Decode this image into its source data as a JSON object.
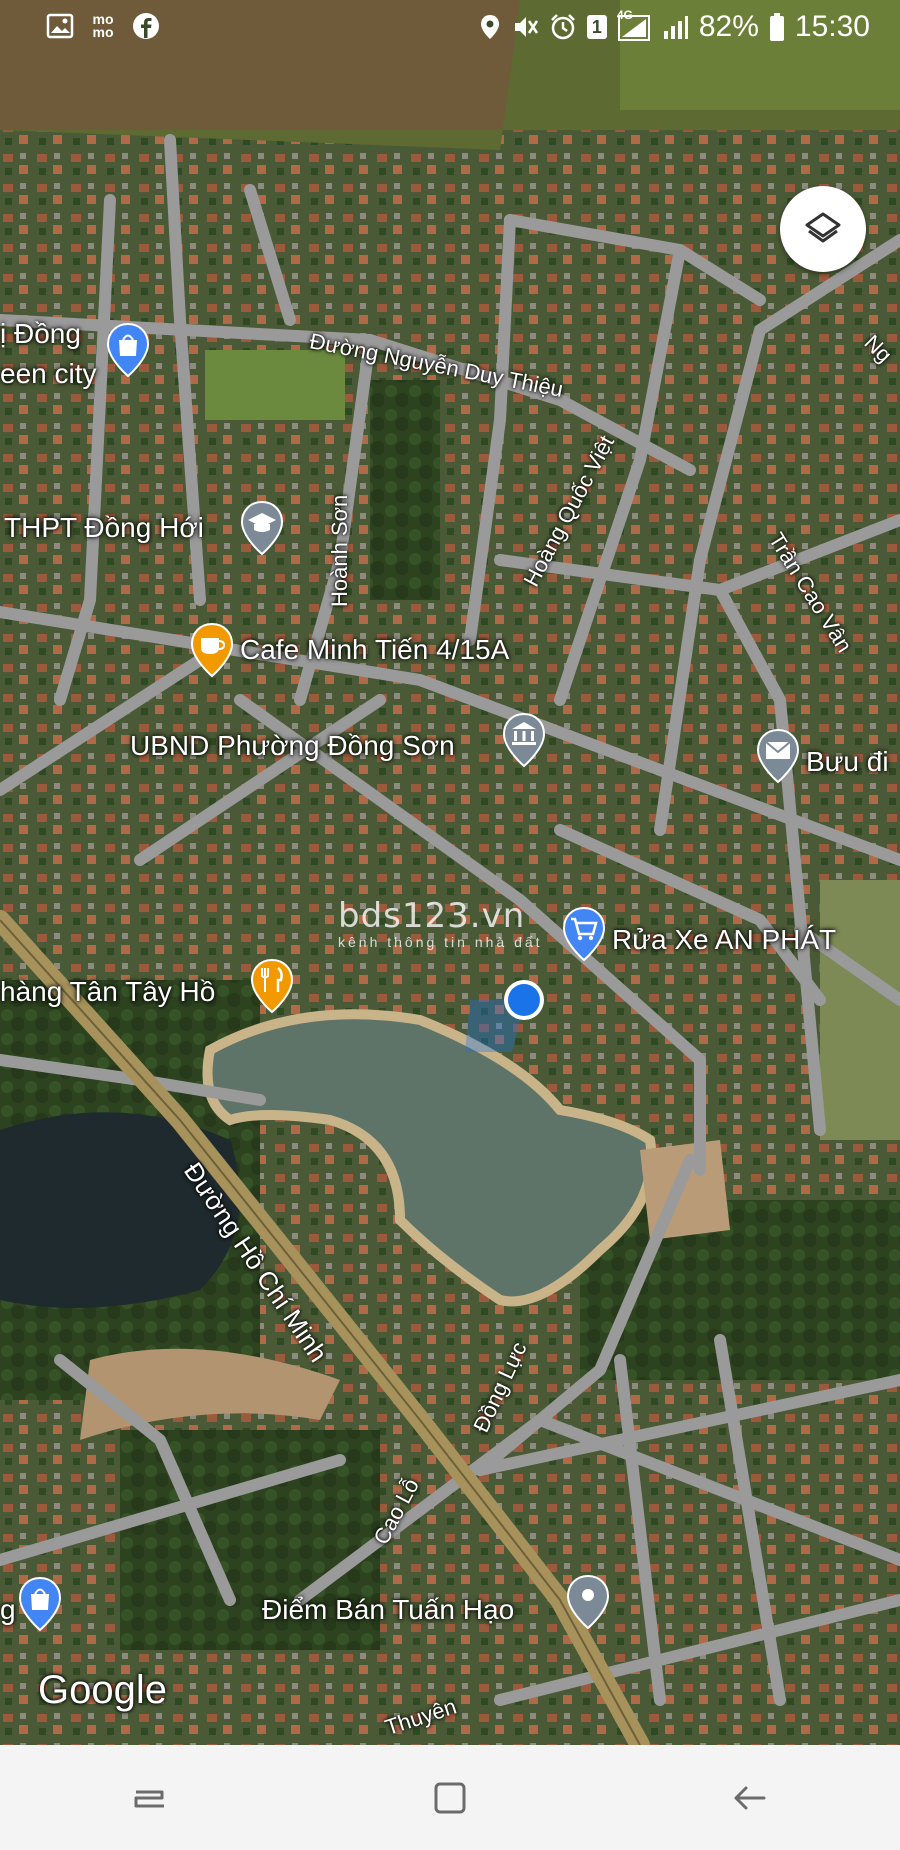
{
  "status_bar": {
    "left_icons": [
      "image-icon",
      "momo-icon",
      "facebook-icon"
    ],
    "momo_text": "mo mo",
    "right_icons": [
      "location-icon",
      "mute-icon",
      "alarm-icon",
      "sim-1-icon",
      "4g-signal-icon",
      "signal-icon",
      "battery-icon"
    ],
    "sim_label": "1",
    "network_label": "4G",
    "battery": "82%",
    "time": "15:30"
  },
  "map": {
    "places": [
      {
        "label": "ị Đồng",
        "icon": "shopping-bag-icon"
      },
      {
        "label": "een city"
      },
      {
        "label": "THPT Đồng Hới",
        "icon": "school-icon"
      },
      {
        "label": "Cafe Minh Tiến 4/15A",
        "icon": "cafe-icon"
      },
      {
        "label": "UBND Phường Đồng Sơn",
        "icon": "government-icon"
      },
      {
        "label": "Bưu đi",
        "icon": "mail-icon"
      },
      {
        "label": "Rửa Xe AN PHÁT",
        "icon": "shopping-cart-icon"
      },
      {
        "label": "hàng Tân Tây Hồ",
        "icon": "restaurant-icon"
      },
      {
        "label": "Điểm Bán Tuấn Hạo",
        "icon": "place-icon"
      },
      {
        "label": "g",
        "icon": "shopping-bag-icon"
      }
    ],
    "roads": [
      "Đường Nguyễn Duy Thiệu",
      "Hoàng Quốc Việt",
      "Hoành Sơn",
      "Trần Cao Vân",
      "Ng",
      "Đường Hồ Chí Minh",
      "Đồng Lực",
      "Cao Lỗ",
      "Thuyên"
    ],
    "watermark_main": "bds123.vn",
    "watermark_sub": "kênh thông tin nhà đất",
    "google_logo": "Google",
    "layers_button_icon": "layers-icon",
    "my_location_icon": "my-location-icon"
  },
  "nav_bar": {
    "buttons": [
      "recent-apps-icon",
      "home-icon",
      "back-icon"
    ]
  },
  "colors": {
    "road": "#9a9a9a",
    "highway": "#a7925c",
    "location_blue": "#1a73e8",
    "pin_orange": "#f29900",
    "pin_blue": "#4285f4",
    "pin_gray": "#7b8a96"
  }
}
